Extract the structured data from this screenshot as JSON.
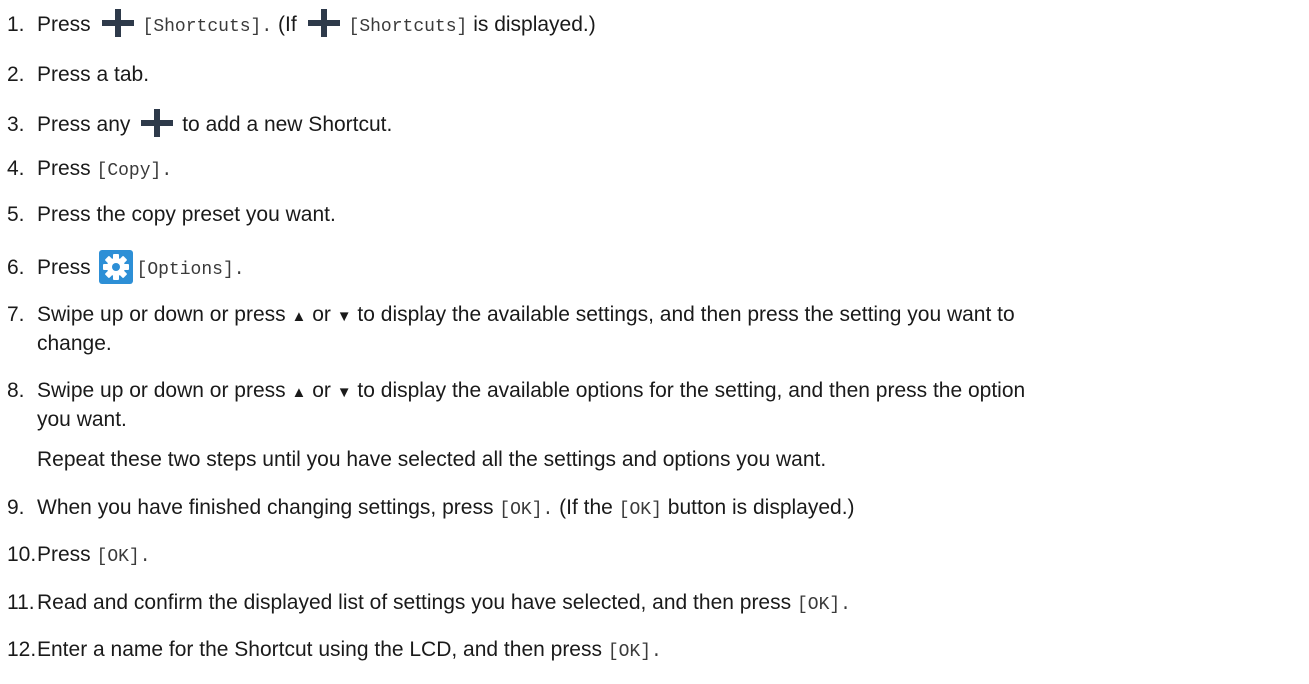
{
  "icons": {
    "plus": "plus-icon",
    "gear": "gear-icon",
    "arrow_up": "▲",
    "arrow_down": "▼"
  },
  "colors": {
    "plus": "#2e3a4a",
    "gear_bg": "#2d8fd6",
    "gear_fg": "#ffffff"
  },
  "steps": [
    {
      "num": "1.",
      "a": "Press",
      "b": "[Shortcuts].",
      "c": "(If",
      "d": "[Shortcuts]",
      "e": "is displayed.)"
    },
    {
      "num": "2.",
      "a": "Press a tab."
    },
    {
      "num": "3.",
      "a": "Press any",
      "b": "to add a new Shortcut."
    },
    {
      "num": "4.",
      "a": "Press",
      "b": "[Copy]."
    },
    {
      "num": "5.",
      "a": "Press the copy preset you want."
    },
    {
      "num": "6.",
      "a": "Press",
      "b": "[Options]."
    },
    {
      "num": "7.",
      "a": "Swipe up or down or press",
      "b": "or",
      "c": "to display the available settings, and then press the setting you want to",
      "d": "change."
    },
    {
      "num": "8.",
      "a": "Swipe up or down or press",
      "b": "or",
      "c": "to display the available options for the setting, and then press the option",
      "d": "you want."
    },
    {
      "num": "9.",
      "a": "When you have finished changing settings, press",
      "b": "[OK].",
      "c": "(If the",
      "d": "[OK]",
      "e": "button is displayed.)"
    },
    {
      "num": "10.",
      "a": "Press",
      "b": "[OK]."
    },
    {
      "num": "11.",
      "a": "Read and confirm the displayed list of settings you have selected, and then press",
      "b": "[OK]."
    },
    {
      "num": "12.",
      "a": "Enter a name for the Shortcut using the LCD, and then press",
      "b": "[OK]."
    }
  ],
  "note": "Repeat these two steps until you have selected all the settings and options you want."
}
